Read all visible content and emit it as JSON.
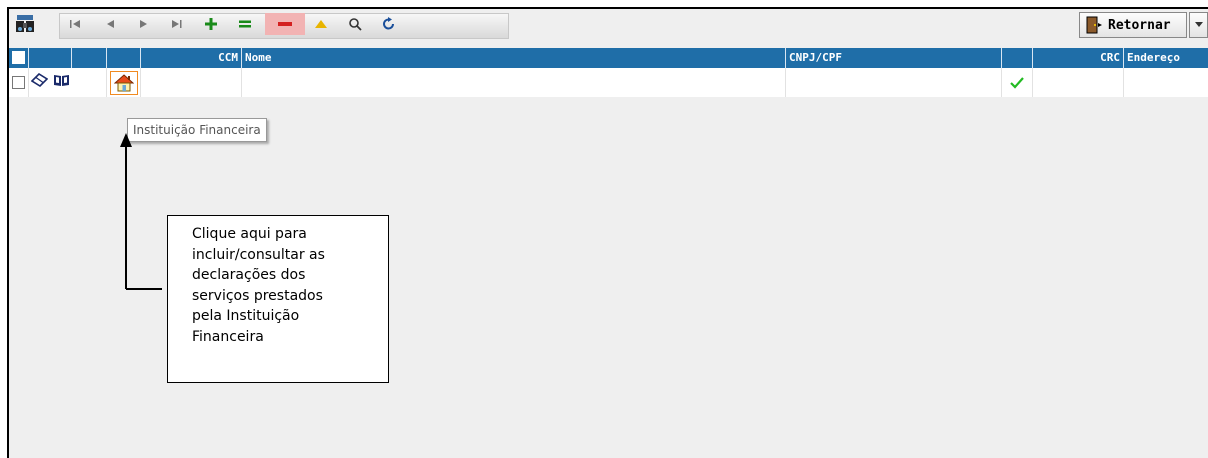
{
  "toolbar": {
    "icons": [
      "binoculars-icon",
      "first-icon",
      "prev-icon",
      "next-icon",
      "last-icon",
      "add-icon",
      "equals-icon",
      "remove-icon",
      "up-icon",
      "search-icon",
      "refresh-icon"
    ],
    "retornar_label": "Retornar"
  },
  "grid": {
    "columns": [
      "",
      "",
      "",
      "",
      "CCM",
      "Nome",
      "CNPJ/CPF",
      "",
      "CRC",
      "Endereço"
    ],
    "row": {
      "ccm": "",
      "nome": "",
      "cnpj": "",
      "crc": "",
      "endereco": ""
    }
  },
  "tooltip": "Instituição Financeira",
  "callout": {
    "lines": [
      "Clique aqui para",
      "incluir/consultar as",
      "declarações dos",
      "serviços prestados",
      "pela Instituição",
      "Financeira"
    ]
  },
  "colors": {
    "header": "#1f6ea8",
    "check": "#22bb22",
    "add": "#1a8a1a",
    "remove": "#d42020",
    "up": "#e8b400"
  }
}
